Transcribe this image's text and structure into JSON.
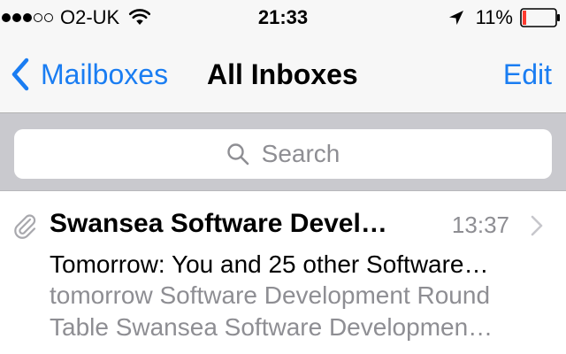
{
  "status_bar": {
    "signal": {
      "filled": 3,
      "total": 5
    },
    "carrier": "O2-UK",
    "time": "21:33",
    "battery_percent": "11%",
    "battery_level": 0.11,
    "battery_color": "#ff3b30",
    "icons": [
      "wifi-icon",
      "location-icon",
      "battery-icon"
    ]
  },
  "nav": {
    "back_label": "Mailboxes",
    "title": "All Inboxes",
    "edit_label": "Edit",
    "accent_color": "#1a7df2"
  },
  "search": {
    "placeholder": "Search"
  },
  "mail_list": [
    {
      "sender": "Swansea Software Devel…",
      "time": "13:37",
      "subject": "Tomorrow: You and 25 other Software…",
      "preview_lines": [
        "tomorrow Software Development Round",
        "Table Swansea Software Developmen…"
      ],
      "has_attachment": true
    }
  ]
}
